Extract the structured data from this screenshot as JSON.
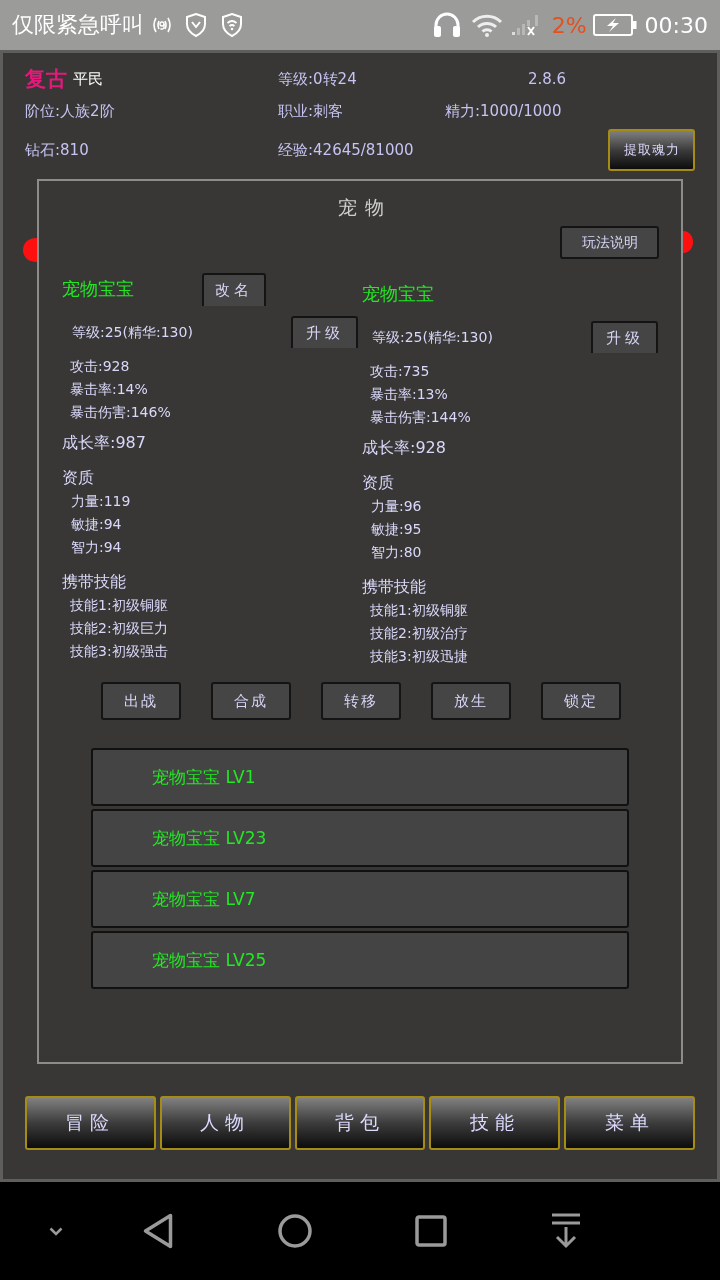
{
  "status_bar": {
    "carrier": "仅限紧急呼叫",
    "battery": "2%",
    "time": "00:30"
  },
  "player": {
    "name": "复古",
    "title": "平民",
    "level": "等级:0转24",
    "version": "2.8.6",
    "rank": "阶位:人族2阶",
    "job": "职业:刺客",
    "energy": "精力:1000/1000",
    "diamonds": "钻石:810",
    "experience": "经验:42645/81000",
    "extract_button": "提取魂力"
  },
  "pet_dialog": {
    "title": "宠物",
    "help_button": "玩法说明",
    "pets": [
      {
        "name": "宠物宝宝",
        "rename_button": "改名",
        "level": "等级:25(精华:130)",
        "upgrade_button": "升级",
        "stats": [
          "攻击:928",
          "暴击率:14%",
          "暴击伤害:146%"
        ],
        "growth": "成长率:987",
        "aptitude_heading": "资质",
        "aptitudes": [
          "力量:119",
          "敏捷:94",
          "智力:94"
        ],
        "skills_heading": "携带技能",
        "skills": [
          "技能1:初级铜躯",
          "技能2:初级巨力",
          "技能3:初级强击"
        ]
      },
      {
        "name": "宠物宝宝",
        "level": "等级:25(精华:130)",
        "upgrade_button": "升级",
        "stats": [
          "攻击:735",
          "暴击率:13%",
          "暴击伤害:144%"
        ],
        "growth": "成长率:928",
        "aptitude_heading": "资质",
        "aptitudes": [
          "力量:96",
          "敏捷:95",
          "智力:80"
        ],
        "skills_heading": "携带技能",
        "skills": [
          "技能1:初级铜躯",
          "技能2:初级治疗",
          "技能3:初级迅捷"
        ]
      }
    ],
    "actions": [
      "出战",
      "合成",
      "转移",
      "放生",
      "锁定"
    ],
    "pet_list": [
      "宠物宝宝 LV1",
      "宠物宝宝 LV23",
      "宠物宝宝 LV7",
      "宠物宝宝 LV25"
    ]
  },
  "bottom_menu": [
    "冒险",
    "人物",
    "背包",
    "技能",
    "菜单"
  ]
}
